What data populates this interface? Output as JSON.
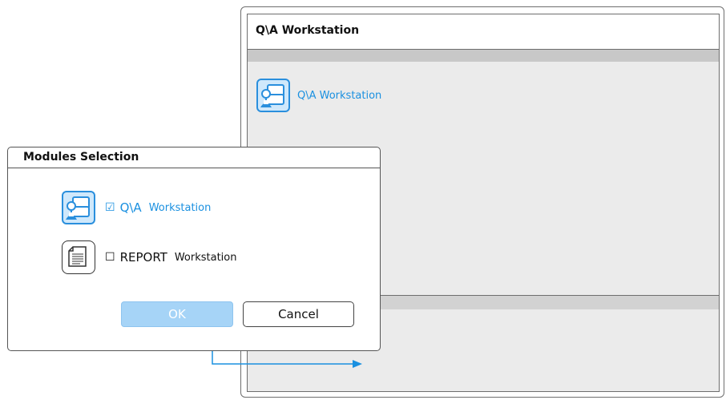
{
  "qa_window": {
    "title": "Q\\A  Workstation",
    "module_label": "Q\\A  Workstation"
  },
  "dialog": {
    "title": "Modules Selection",
    "modules": [
      {
        "check": "☑",
        "label": "Q\\A",
        "sub": "Workstation",
        "checked": true
      },
      {
        "check": "☐",
        "label": "REPORT",
        "sub": "Workstation",
        "checked": false
      }
    ],
    "ok_label": "OK",
    "cancel_label": "Cancel"
  },
  "colors": {
    "accent": "#1a90e0",
    "ok_button": "#a6d4f7",
    "panel_bg": "#ebebeb",
    "connector": "#1a90e0"
  },
  "icons": [
    "workstation-icon",
    "report-document-icon"
  ]
}
